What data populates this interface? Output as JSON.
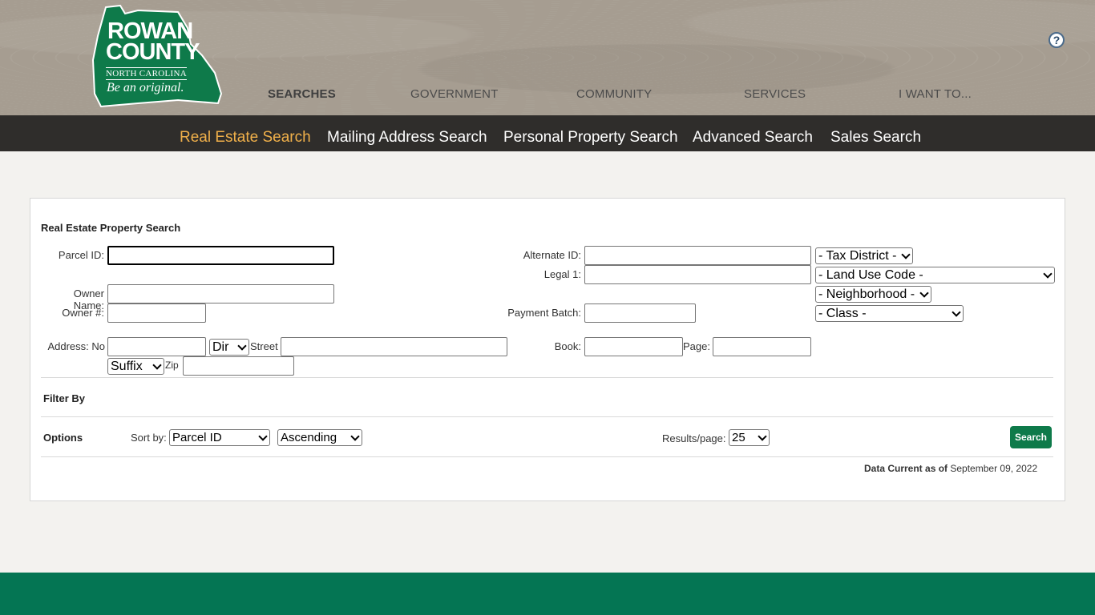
{
  "logo": {
    "line1": "ROWAN",
    "line2": "COUNTY",
    "line3": "NORTH CAROLINA",
    "tagline": "Be an original."
  },
  "help_icon": "question-mark",
  "top_nav": {
    "searches": "SEARCHES",
    "government": "GOVERNMENT",
    "community": "COMMUNITY",
    "services": "SERVICES",
    "i_want_to": "I WANT TO..."
  },
  "sub_nav": {
    "real_estate": "Real Estate Search",
    "mailing_address": "Mailing Address Search",
    "personal_property": "Personal Property Search",
    "advanced": "Advanced Search",
    "sales": "Sales Search"
  },
  "form": {
    "title": "Real Estate Property Search",
    "labels": {
      "parcel_id": "Parcel ID:",
      "owner_name": "Owner Name:",
      "owner_num": "Owner #:",
      "address_no": "Address: No",
      "street": "Street",
      "zip": "Zip",
      "alternate_id": "Alternate ID:",
      "legal1": "Legal 1:",
      "payment_batch": "Payment Batch:",
      "book": "Book:",
      "page": "Page:"
    },
    "selects": {
      "dir": "Dir",
      "suffix": "Suffix",
      "tax_district": "- Tax District -",
      "land_use": "- Land Use Code -",
      "neighborhood": "- Neighborhood -",
      "class": "- Class -"
    },
    "filter_by": "Filter By",
    "options": "Options",
    "sort_by_label": "Sort by:",
    "sort_field": "Parcel ID",
    "sort_order": "Ascending",
    "results_label": "Results/page:",
    "results_value": "25",
    "search_button": "Search",
    "data_current_label": "Data Current as of",
    "data_current_date": "September 09, 2022"
  },
  "colors": {
    "header_bg": "#a69d91",
    "subnav_bg": "#2f2d2b",
    "active_tab": "#f0b04a",
    "brand_green": "#0e7a4a",
    "footer": "#047553"
  }
}
